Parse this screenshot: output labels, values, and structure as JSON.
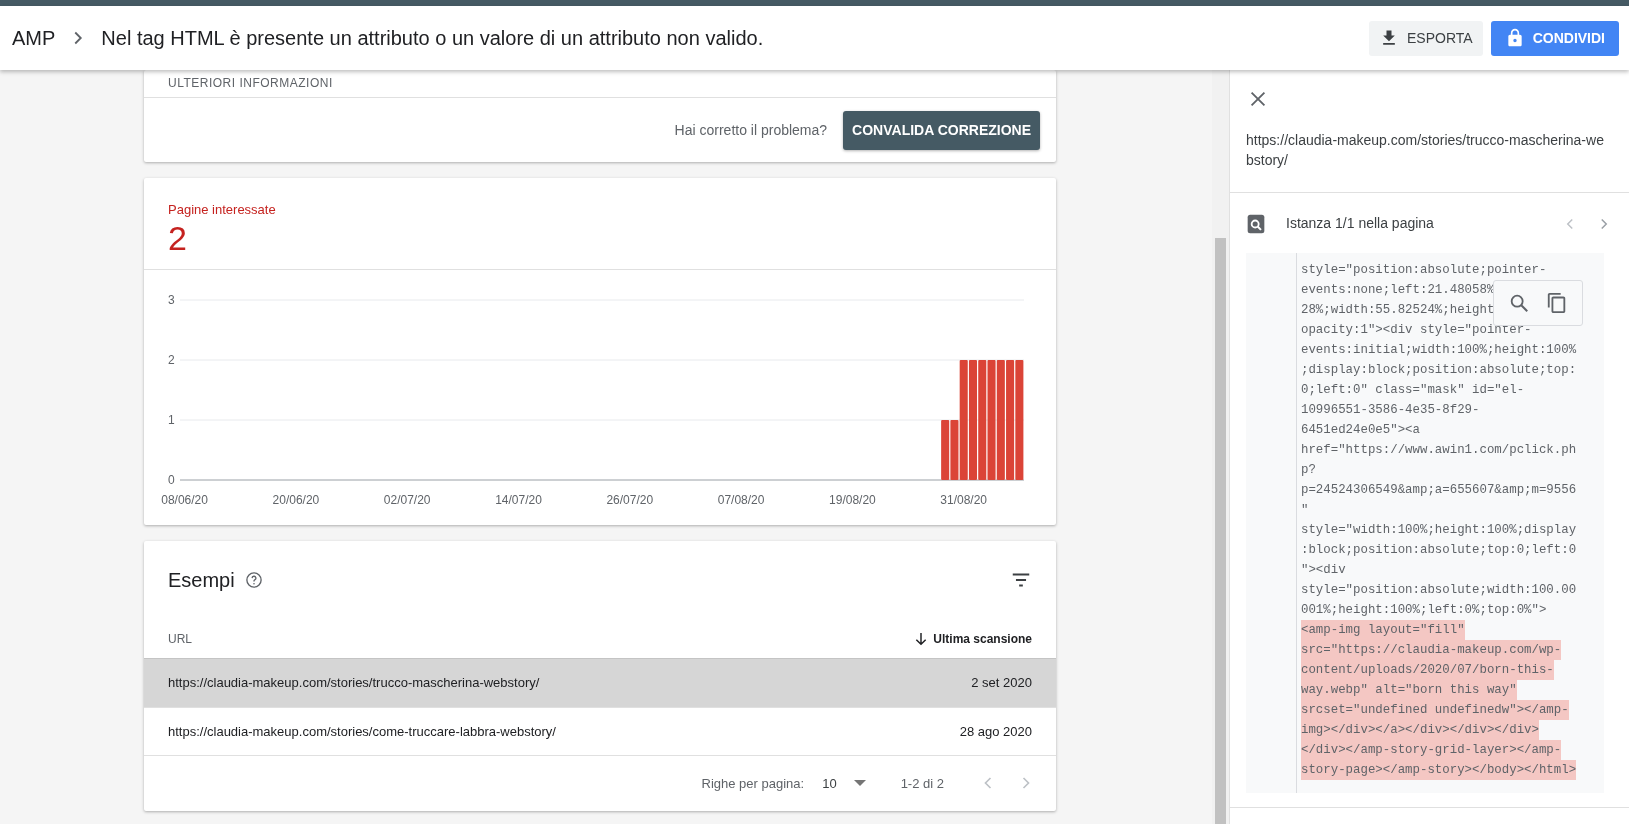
{
  "header": {
    "breadcrumb": "AMP",
    "title": "Nel tag HTML è presente un attributo o un valore di un attributo non valido.",
    "buttons": [
      {
        "kind": "export",
        "label": "ESPORTA"
      },
      {
        "kind": "share",
        "label": "CONDIVIDI"
      }
    ]
  },
  "info_card": {
    "section_label": "ULTERIORI INFORMAZIONI",
    "question": "Hai corretto il problema?",
    "button": "CONVALIDA CORREZIONE"
  },
  "affected_card": {
    "label": "Pagine interessate",
    "count": "2",
    "chart_data": {
      "type": "bar",
      "categories": [
        "08/06/20",
        null,
        null,
        null,
        null,
        null,
        null,
        null,
        null,
        null,
        null,
        null,
        "20/06/20",
        null,
        null,
        null,
        null,
        null,
        null,
        null,
        null,
        null,
        null,
        null,
        "02/07/20",
        null,
        null,
        null,
        null,
        null,
        null,
        null,
        null,
        null,
        null,
        null,
        "14/07/20",
        null,
        null,
        null,
        null,
        null,
        null,
        null,
        null,
        null,
        null,
        null,
        "26/07/20",
        null,
        null,
        null,
        null,
        null,
        null,
        null,
        null,
        null,
        null,
        null,
        "07/08/20",
        null,
        null,
        null,
        null,
        null,
        null,
        null,
        null,
        null,
        null,
        null,
        "19/08/20",
        null,
        null,
        null,
        null,
        null,
        null,
        null,
        null,
        null,
        null,
        null,
        "31/08/20",
        null,
        null,
        null,
        null,
        null,
        null
      ],
      "series": [
        {
          "color": "#db4437",
          "values": [
            0,
            0,
            0,
            0,
            0,
            0,
            0,
            0,
            0,
            0,
            0,
            0,
            0,
            0,
            0,
            0,
            0,
            0,
            0,
            0,
            0,
            0,
            0,
            0,
            0,
            0,
            0,
            0,
            0,
            0,
            0,
            0,
            0,
            0,
            0,
            0,
            0,
            0,
            0,
            0,
            0,
            0,
            0,
            0,
            0,
            0,
            0,
            0,
            0,
            0,
            0,
            0,
            0,
            0,
            0,
            0,
            0,
            0,
            0,
            0,
            0,
            0,
            0,
            0,
            0,
            0,
            0,
            0,
            0,
            0,
            0,
            0,
            0,
            0,
            0,
            0,
            0,
            0,
            0,
            0,
            0,
            0,
            1,
            1,
            2,
            2,
            2,
            2,
            2,
            2,
            2
          ]
        }
      ],
      "ylim": [
        0,
        3
      ],
      "yticks": [
        0,
        1,
        2,
        3
      ]
    }
  },
  "examples": {
    "title": "Esempi",
    "columns": [
      "URL",
      "Ultima scansione"
    ],
    "rows": [
      {
        "url": "https://claudia-makeup.com/stories/trucco-mascherina-webstory/",
        "date": "2 set 2020",
        "selected": true
      },
      {
        "url": "https://claudia-makeup.com/stories/come-truccare-labbra-webstory/",
        "date": "28 ago 2020",
        "selected": false
      }
    ],
    "pagination": {
      "rows_label": "Righe per pagina:",
      "rows_value": "10",
      "range": "1-2 di 2"
    }
  },
  "detail_panel": {
    "url": "https://claudia-makeup.com/stories/trucco-mascherina-webstory/",
    "instance": "Istanza 1/1 nella pagina",
    "code_lines": [
      {
        "text": "style=\"position:absolute;pointer-",
        "highlighted": false
      },
      {
        "text": "events:none;left:21.48058%",
        "highlighted": false
      },
      {
        "text": "28%;width:55.82524%;height",
        "highlighted": false
      },
      {
        "text": "opacity:1\"><div style=\"pointer-",
        "highlighted": false
      },
      {
        "text": "events:initial;width:100%;height:100%",
        "highlighted": false
      },
      {
        "text": ";display:block;position:absolute;top:",
        "highlighted": false
      },
      {
        "text": "0;left:0\" class=\"mask\" id=\"el-",
        "highlighted": false
      },
      {
        "text": "10996551-3586-4e35-8f29-",
        "highlighted": false
      },
      {
        "text": "6451ed24e0e5\"><a",
        "highlighted": false
      },
      {
        "text": "href=\"https://www.awin1.com/pclick.ph",
        "highlighted": false
      },
      {
        "text": "p?",
        "highlighted": false
      },
      {
        "text": "p=24524306549&amp;a=655607&amp;m=9556",
        "highlighted": false
      },
      {
        "text": "\"",
        "highlighted": false
      },
      {
        "text": "style=\"width:100%;height:100%;display",
        "highlighted": false
      },
      {
        "text": ":block;position:absolute;top:0;left:0",
        "highlighted": false
      },
      {
        "text": "\"><div",
        "highlighted": false
      },
      {
        "text": "style=\"position:absolute;width:100.00",
        "highlighted": false
      },
      {
        "text": "001%;height:100%;left:0%;top:0%\">",
        "highlighted": false
      },
      {
        "text": "<amp-img layout=\"fill\"",
        "highlighted": true
      },
      {
        "text": "src=\"https://claudia-makeup.com/wp-",
        "highlighted": true
      },
      {
        "text": "content/uploads/2020/07/born-this-",
        "highlighted": true
      },
      {
        "text": "way.webp\" alt=\"born this way\"",
        "highlighted": true
      },
      {
        "text": "srcset=\"undefined undefinedw\"></amp-",
        "highlighted": true
      },
      {
        "text": "img></div></a></div></div></div>",
        "highlighted": true
      },
      {
        "text": "</div></amp-story-grid-layer></amp-",
        "highlighted": true
      },
      {
        "text": "story-page></amp-story></body></html>",
        "highlighted": true
      }
    ]
  }
}
